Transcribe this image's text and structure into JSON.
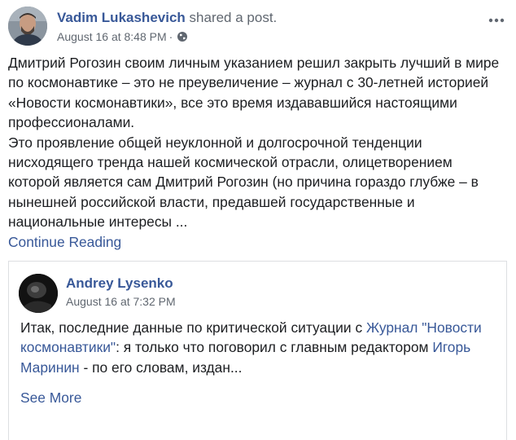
{
  "post": {
    "author": "Vadim Lukashevich",
    "action": "shared a post.",
    "date": "August 16 at 8:48 PM",
    "separator": "·",
    "icons": {
      "privacy": "globe-icon",
      "options": "more-options-icon"
    },
    "text_lines": [
      "Дмитрий Рогозин своим личным указанием решил закрыть лучший в мире",
      "по космонавтике – это не преувеличение – журнал с 30-летней историей",
      "«Новости космонавтики», все это время издававшийся настоящими",
      "профессионалами.",
      "Это проявление общей неуклонной и долгосрочной тенденции",
      "нисходящего тренда нашей космической отрасли, олицетворением",
      "которой является сам Дмитрий Рогозин (но причина гораздо глубже – в",
      "нынешней российской власти, предавшей государственные и",
      "национальные интересы ..."
    ],
    "continue_label": "Continue Reading"
  },
  "shared": {
    "author": "Andrey Lysenko",
    "date": "August 16 at 7:32 PM",
    "text_1": "Итак, последние данные по критической ситуации с ",
    "link_1": "Журнал \"Новости космонавтики\"",
    "text_2": ": я только что поговорил с главным редактором ",
    "link_2": "Игорь Маринин",
    "text_3": " - по его словам, издан...",
    "see_more_label": "See More"
  },
  "colors": {
    "link": "#385898",
    "secondary_text": "#606770",
    "border": "#dddfe2"
  }
}
